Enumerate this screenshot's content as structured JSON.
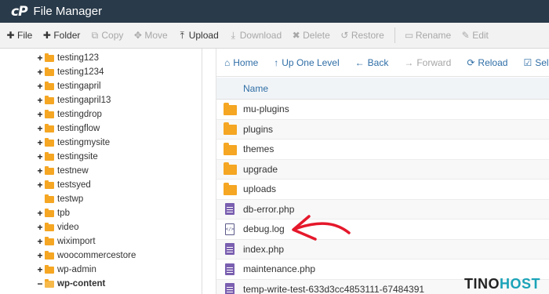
{
  "app": {
    "logo": "cP",
    "title": "File Manager"
  },
  "toolbar": {
    "file": "File",
    "folder": "Folder",
    "copy": "Copy",
    "move": "Move",
    "upload": "Upload",
    "download": "Download",
    "delete": "Delete",
    "restore": "Restore",
    "rename": "Rename",
    "edit": "Edit"
  },
  "tree": {
    "items": [
      {
        "label": "testing123",
        "expander": "+"
      },
      {
        "label": "testing1234",
        "expander": "+"
      },
      {
        "label": "testingapril",
        "expander": "+"
      },
      {
        "label": "testingapril13",
        "expander": "+"
      },
      {
        "label": "testingdrop",
        "expander": "+"
      },
      {
        "label": "testingflow",
        "expander": "+"
      },
      {
        "label": "testingmysite",
        "expander": "+"
      },
      {
        "label": "testingsite",
        "expander": "+"
      },
      {
        "label": "testnew",
        "expander": "+"
      },
      {
        "label": "testsyed",
        "expander": "+"
      },
      {
        "label": "testwp",
        "expander": ""
      },
      {
        "label": "tpb",
        "expander": "+"
      },
      {
        "label": "video",
        "expander": "+"
      },
      {
        "label": "wiximport",
        "expander": "+"
      },
      {
        "label": "woocommercestore",
        "expander": "+"
      },
      {
        "label": "wp-admin",
        "expander": "+"
      },
      {
        "label": "wp-content",
        "expander": "−"
      }
    ]
  },
  "nav": {
    "home": "Home",
    "up": "Up One Level",
    "back": "Back",
    "forward": "Forward",
    "reload": "Reload",
    "select": "Sel"
  },
  "table": {
    "name_header": "Name",
    "files": [
      {
        "name": "mu-plugins",
        "icon": "folder-icon"
      },
      {
        "name": "plugins",
        "icon": "folder-icon"
      },
      {
        "name": "themes",
        "icon": "folder-icon"
      },
      {
        "name": "upgrade",
        "icon": "folder-icon"
      },
      {
        "name": "uploads",
        "icon": "folder-icon"
      },
      {
        "name": "db-error.php",
        "icon": "php-file-icon"
      },
      {
        "name": "debug.log",
        "icon": "code-file-icon"
      },
      {
        "name": "index.php",
        "icon": "php-file-icon"
      },
      {
        "name": "maintenance.php",
        "icon": "php-file-icon"
      },
      {
        "name": "temp-write-test-633d3cc4853111-67484391",
        "icon": "php-file-icon"
      }
    ]
  },
  "watermark": {
    "part1": "TINO",
    "part2": "HOST"
  },
  "colors": {
    "titlebar": "#293a4a",
    "link": "#2f6ea6",
    "folder": "#f5a623",
    "php": "#7a5fb0",
    "arrow": "#e5182b"
  }
}
